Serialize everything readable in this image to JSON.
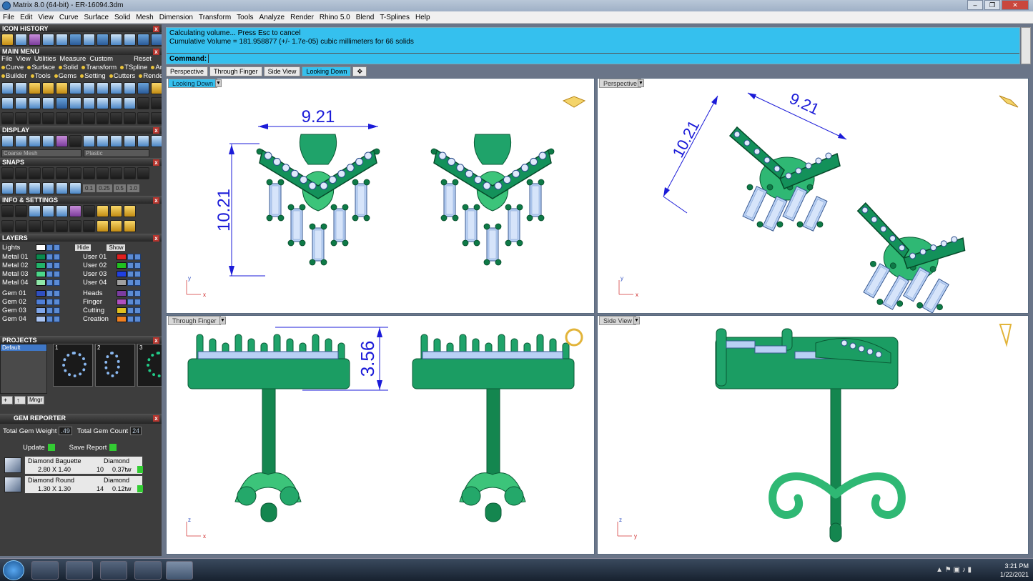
{
  "window": {
    "title": "Matrix 8.0 (64-bit) - ER-16094.3dm"
  },
  "menu": [
    "File",
    "Edit",
    "View",
    "Curve",
    "Surface",
    "Solid",
    "Mesh",
    "Dimension",
    "Transform",
    "Tools",
    "Analyze",
    "Render",
    "Rhino 5.0",
    "Blend",
    "T-Splines",
    "Help"
  ],
  "panel": {
    "icon_history": "ICON HISTORY",
    "main_menu": "MAIN MENU",
    "main_menu_items": [
      "File",
      "View",
      "Utilities",
      "Measure",
      "Custom"
    ],
    "reset": "Reset",
    "row1": [
      "Curve",
      "Surface",
      "Solid",
      "Transform",
      "TSpline",
      "Art"
    ],
    "row2": [
      "Builder",
      "Tools",
      "Gems",
      "Setting",
      "Cutters",
      "Render"
    ],
    "display": "DISPLAY",
    "display_mesh": "Coarse Mesh",
    "display_material": "Plastic",
    "snaps": "SNAPS",
    "snap_values": [
      "0.1",
      "0.25",
      "0.5",
      "1.0"
    ],
    "info": "INFO & SETTINGS",
    "layers": "LAYERS",
    "lights": "Lights",
    "hide": "Hide",
    "show": "Show",
    "layers_left": [
      "Metal 01",
      "Metal 02",
      "Metal 03",
      "Metal 04",
      "Gem 01",
      "Gem 02",
      "Gem 03",
      "Gem 04"
    ],
    "layers_right": [
      "User 01",
      "User 02",
      "User 03",
      "User 04",
      "Heads",
      "Finger",
      "Cutting",
      "Creation"
    ],
    "layer_colors_left": [
      "#0a8a4e",
      "#22b26a",
      "#4cd88a",
      "#8fe8a8",
      "#2f4fbf",
      "#4f7fd8",
      "#7fa6ea",
      "#a9c4f2"
    ],
    "layer_colors_right": [
      "#e02020",
      "#20c020",
      "#2040e0",
      "#a0a0a0",
      "#7a3ca0",
      "#b050c0",
      "#e0c020",
      "#f08020"
    ],
    "projects": "PROJECTS",
    "project_default": "Default",
    "project_nums": [
      "1",
      "2",
      "3"
    ],
    "mngr": "Mngr",
    "gem_reporter": "GEM REPORTER",
    "total_gem_weight_label": "Total Gem Weight",
    "total_gem_weight": ".49",
    "total_gem_count_label": "Total Gem Count",
    "total_gem_count": "24",
    "update": "Update",
    "save_report": "Save Report",
    "gems": [
      {
        "name": "Diamond Baguette",
        "size": "2.80 X 1.40",
        "material": "Diamond",
        "count": "10",
        "weight": "0.37tw"
      },
      {
        "name": "Diamond Round",
        "size": "1.30 X 1.30",
        "material": "Diamond",
        "count": "14",
        "weight": "0.12tw"
      }
    ]
  },
  "command": {
    "line1": "Calculating volume... Press Esc to cancel",
    "line2": "Cumulative Volume = 181.958877 (+/- 1.7e-05) cubic millimeters for 66 solids",
    "prompt": "Command:"
  },
  "tabs": [
    "Perspective",
    "Through Finger",
    "Side View",
    "Looking Down"
  ],
  "active_tab": "Looking Down",
  "viewports": {
    "top_left": {
      "label": "Looking Down",
      "dim_w": "9.21",
      "dim_h": "10.21",
      "axis_a": "y",
      "axis_b": "x"
    },
    "top_right": {
      "label": "Perspective",
      "dim_w": "9.21",
      "dim_h": "10.21",
      "axis_a": "y",
      "axis_b": "x"
    },
    "bottom_left": {
      "label": "Through Finger",
      "dim_h": "3.56",
      "axis_a": "z",
      "axis_b": "x"
    },
    "bottom_right": {
      "label": "Side View",
      "axis_a": "z",
      "axis_b": "y"
    }
  },
  "tray": {
    "time": "3:21 PM",
    "date": "1/22/2021"
  },
  "colors": {
    "metal": "#1fa36a",
    "gem": "#b8d0f5",
    "dimension": "#1b1bd8",
    "accent": "#35c0ee"
  }
}
